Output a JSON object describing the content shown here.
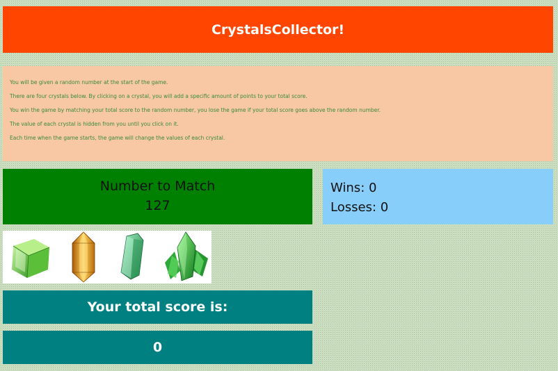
{
  "header": {
    "title": "CrystalsCollector!"
  },
  "instructions": [
    "You will be given a random number at the start of the game.",
    "There are four crystals below. By clicking on a crystal, you will add a specific amount of points to your total score.",
    "You win the game by matching your total score to the random number, you lose the game if your total score goes above the random number.",
    "The value of each crystal is hidden from you until you click on it.",
    "Each time when the game starts, the game will change the values of each crystal."
  ],
  "target": {
    "label": "Number to Match",
    "value": "127"
  },
  "stats": {
    "wins": "Wins: 0",
    "losses": "Losses: 0"
  },
  "crystals": [
    {
      "icon": "green-cube-crystal-icon",
      "color": "#6fd24a"
    },
    {
      "icon": "amber-crystal-icon",
      "color": "#e8961c"
    },
    {
      "icon": "green-prism-crystal-icon",
      "color": "#3aaa6a"
    },
    {
      "icon": "green-cluster-crystal-icon",
      "color": "#2fae3f"
    }
  ],
  "score": {
    "label": "Your total score is:",
    "value": "0"
  },
  "colors": {
    "header": "#ff4500",
    "instructions_bg": "#f7c8a3",
    "target_bg": "#008000",
    "stats_bg": "#87cefa",
    "score_bg": "#008080"
  }
}
